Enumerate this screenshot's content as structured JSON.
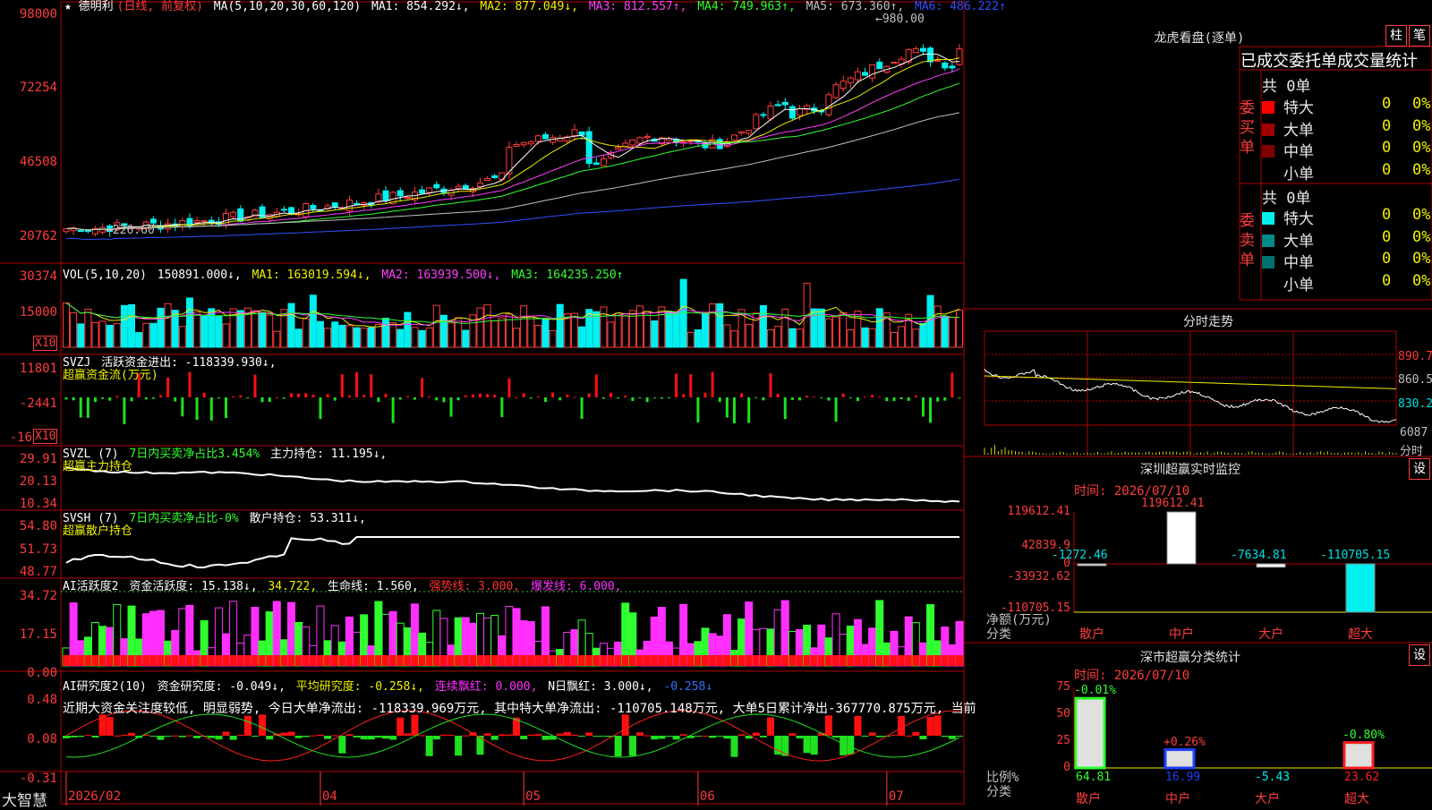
{
  "brand": "大智慧",
  "colors": {
    "up": "#ff3c3c",
    "down": "#00f0f0",
    "ma1": "#ffffff",
    "ma2": "#f0f000",
    "ma3": "#ff40ff",
    "ma4": "#30ff30",
    "ma5": "#c0c0c0",
    "ma6": "#3050ff",
    "buy_big": "#ff0000",
    "sell_big": "#00f0f0",
    "green": "#30ff30",
    "magenta": "#ff30ff",
    "yellow": "#f0f000"
  },
  "price_header": {
    "star_title": "★ 德明利",
    "mode": "(日线, 前复权)",
    "ma_params": "MA(5,10,20,30,60,120)",
    "ma1": "MA1: 854.292↓,",
    "ma2": "MA2: 877.049↓,",
    "ma3": "MA3: 812.557↑,",
    "ma4": "MA4: 749.963↑,",
    "ma5": "MA5: 673.360↑,",
    "ma6": "MA6: 486.222↑"
  },
  "price_annotations": {
    "high": "980.00",
    "low": "226.60"
  },
  "vol_header": {
    "name": "VOL(5,10,20)",
    "value": "150891.000↓,",
    "ma1": "MA1: 163019.594↓,",
    "ma2": "MA2: 163939.500↓,",
    "ma3": "MA3: 164235.250↑"
  },
  "svzj_header": {
    "name": "SVZJ",
    "label": "活跃资金进出: -118339.930↓,",
    "sub": "超赢资金流(万元)"
  },
  "svzl_header": {
    "name": "SVZL (7)",
    "label": "7日内买卖净占比3.454%",
    "hold": "主力持仓: 11.195↓,",
    "sub": "超赢主力持仓"
  },
  "svsh_header": {
    "name": "SVSH (7)",
    "label": "7日内买卖净占比-0%",
    "hold": "散户持仓: 53.311↓,",
    "sub": "超赢散户持仓"
  },
  "ai1_header": {
    "name": "AI活跃度2",
    "a": "资金活跃度: 15.138↓,",
    "b": "34.722,",
    "c": "生命线: 1.560,",
    "d": "强势线: 3.000,",
    "e": "爆发线: 6.000,"
  },
  "ai2_header": {
    "name": "AI研究度2(10)",
    "a": "资金研究度: -0.049↓,",
    "b": "平均研究度: -0.258↓,",
    "c": "连续飘红: 0.000,",
    "d": "N日飘红: 3.000↓,",
    "e": "-0.258↓"
  },
  "ai2_comment": "近期大资金关注度较低, 明显弱势, 今日大单净流出: -118339.969万元, 其中特大单净流出: -110705.148万元, 大单5日累计净出-367770.875万元, 当前",
  "x_ticks": [
    {
      "label": "2026/02",
      "idx": 0
    },
    {
      "label": "04",
      "idx": 35
    },
    {
      "label": "05",
      "idx": 63
    },
    {
      "label": "06",
      "idx": 87
    },
    {
      "label": "07",
      "idx": 113
    }
  ],
  "y_labels": {
    "price": [
      "98000",
      "72254",
      "46508",
      "20762"
    ],
    "vol": [
      "30374",
      "15000"
    ],
    "vol_unit": "X10",
    "svzj": [
      "11801",
      "-2441",
      "-16"
    ],
    "svzj_unit": "X10",
    "svzl": [
      "29.91",
      "20.13",
      "10.34"
    ],
    "svsh": [
      "54.80",
      "51.73",
      "48.77"
    ],
    "ai1": [
      "34.72",
      "17.15",
      "0.00"
    ],
    "ai2": [
      "0.48",
      "0.08",
      "-0.31"
    ]
  },
  "right": {
    "lhb_title": "龙虎看盘(逐单)",
    "btn_bar": "柱",
    "btn_pen": "笔",
    "tabs": "已成交委托单成交量统计",
    "buy_label": "委买单",
    "sell_label": "委卖单",
    "buy_total": "共 0单",
    "sell_total": "共 0单",
    "buy_rows": [
      {
        "name": "特大",
        "count": "0",
        "pct": "0%",
        "color": "#ff0000"
      },
      {
        "name": "大单",
        "count": "0",
        "pct": "0%",
        "color": "#a00000"
      },
      {
        "name": "中单",
        "count": "0",
        "pct": "0%",
        "color": "#800000"
      },
      {
        "name": "小单",
        "count": "0",
        "pct": "0%",
        "color": ""
      }
    ],
    "sell_rows": [
      {
        "name": "特大",
        "count": "0",
        "pct": "0%",
        "color": "#00f0f0"
      },
      {
        "name": "大单",
        "count": "0",
        "pct": "0%",
        "color": "#008a8a"
      },
      {
        "name": "中单",
        "count": "0",
        "pct": "0%",
        "color": "#007070"
      },
      {
        "name": "小单",
        "count": "0",
        "pct": "0%",
        "color": ""
      }
    ],
    "intraday_title": "分时走势",
    "intraday_y": [
      "890.7",
      "860.5",
      "830.2"
    ],
    "intraday_vol": "6087",
    "intraday_vol_unit": "分时",
    "sz_title": "深圳超赢实时监控",
    "sz_btn": "设",
    "sz_time": "时间: 2026/07/10",
    "sz_y": [
      "119612.41",
      "42839.9",
      "0",
      "-33932.62",
      "-110705.15"
    ],
    "sz_unit": "净额(万元)",
    "sz_cat_label": "分类",
    "sz_bars": [
      {
        "name": "散户",
        "value": -1272.46,
        "label": "-1272.46",
        "color": "#ffffff"
      },
      {
        "name": "中户",
        "value": 119612.41,
        "label": "119612.41",
        "color": "#ffffff"
      },
      {
        "name": "大户",
        "value": -7634.81,
        "label": "-7634.81",
        "color": "#ffffff"
      },
      {
        "name": "超大",
        "value": -110705.15,
        "label": "-110705.15",
        "color": "#00f0f0"
      }
    ],
    "sm_title": "深市超赢分类统计",
    "sm_btn": "设",
    "sm_time": "时间: 2026/07/10",
    "sm_y": [
      "75",
      "50",
      "25",
      "0"
    ],
    "sm_unit": "比例%",
    "sm_cat_label": "分类",
    "sm_bars": [
      {
        "name": "散户",
        "value": 64.81,
        "label": "64.81",
        "delta": "-0.01%",
        "color": "#30ff30",
        "val_color": "#30ff30"
      },
      {
        "name": "中户",
        "value": 16.99,
        "label": "16.99",
        "delta": "+0.26%",
        "color": "#2040ff",
        "val_color": "#2040ff"
      },
      {
        "name": "大户",
        "value": -5.43,
        "label": "-5.43",
        "delta": "",
        "color": "#00f0f0",
        "val_color": "#00f0f0"
      },
      {
        "name": "超大",
        "value": 23.62,
        "label": "23.62",
        "delta": "-0.80%",
        "color": "#ff2020",
        "val_color": "#ff2020"
      }
    ]
  },
  "chart_data": [
    {
      "type": "candlestick",
      "title": "德明利 日线 前复权",
      "ylim": [
        20762,
        98000
      ],
      "x_labels": [
        "2026/02",
        "04",
        "05",
        "06",
        "07"
      ],
      "series": [
        {
          "name": "MA1",
          "last": 854.292
        },
        {
          "name": "MA2",
          "last": 877.049
        },
        {
          "name": "MA3",
          "last": 812.557
        },
        {
          "name": "MA4",
          "last": 749.963
        },
        {
          "name": "MA5",
          "last": 673.36
        },
        {
          "name": "MA6",
          "last": 486.222
        }
      ],
      "annotations": {
        "high": 980.0,
        "low": 226.6
      }
    },
    {
      "type": "bar",
      "name": "VOL",
      "last": 150891.0,
      "ylim": [
        0,
        30374
      ]
    },
    {
      "type": "bar",
      "name": "SVZJ",
      "last": -118339.93
    },
    {
      "type": "line",
      "name": "SVZL",
      "last": 11.195,
      "ylim": [
        10.34,
        29.91
      ]
    },
    {
      "type": "line",
      "name": "SVSH",
      "last": 53.311,
      "ylim": [
        48.77,
        54.8
      ]
    },
    {
      "type": "bar",
      "name": "AI活跃度2",
      "last": 15.138,
      "ylim": [
        0,
        34.72
      ]
    },
    {
      "type": "bar",
      "name": "AI研究度2",
      "last": -0.049,
      "ylim": [
        -0.31,
        0.48
      ]
    },
    {
      "type": "bar",
      "name": "深圳超赢实时监控",
      "categories": [
        "散户",
        "中户",
        "大户",
        "超大"
      ],
      "values": [
        -1272.46,
        119612.41,
        -7634.81,
        -110705.15
      ]
    },
    {
      "type": "bar",
      "name": "深市超赢分类统计",
      "categories": [
        "散户",
        "中户",
        "大户",
        "超大"
      ],
      "values": [
        64.81,
        16.99,
        -5.43,
        23.62
      ]
    }
  ]
}
